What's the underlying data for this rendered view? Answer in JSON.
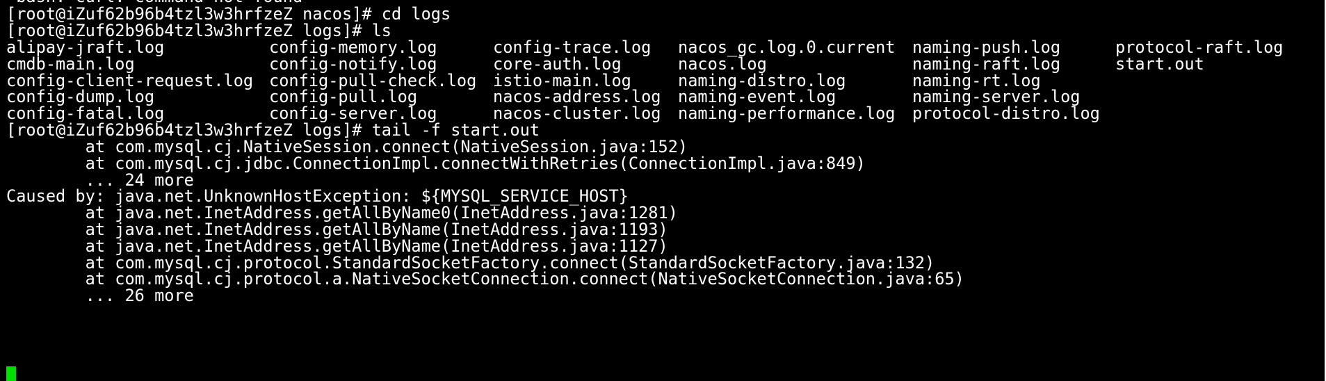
{
  "terminal": {
    "top_partial": "-bash: curl: command not found",
    "prompt_cd": "[root@iZuf62b96b4tzl3w3hrfzeZ nacos]# cd logs",
    "prompt_ls": "[root@iZuf62b96b4tzl3w3hrfzeZ logs]# ls",
    "ls_rows": [
      [
        "alipay-jraft.log",
        "config-memory.log",
        "config-trace.log",
        "nacos_gc.log.0.current",
        "naming-push.log",
        "protocol-raft.log"
      ],
      [
        "cmdb-main.log",
        "config-notify.log",
        "core-auth.log",
        "nacos.log",
        "naming-raft.log",
        "start.out"
      ],
      [
        "config-client-request.log",
        "config-pull-check.log",
        "istio-main.log",
        "naming-distro.log",
        "naming-rt.log",
        ""
      ],
      [
        "config-dump.log",
        "config-pull.log",
        "nacos-address.log",
        "naming-event.log",
        "naming-server.log",
        ""
      ],
      [
        "config-fatal.log",
        "config-server.log",
        "nacos-cluster.log",
        "naming-performance.log",
        "protocol-distro.log",
        ""
      ]
    ],
    "prompt_tail": "[root@iZuf62b96b4tzl3w3hrfzeZ logs]# tail -f start.out",
    "output": [
      "        at com.mysql.cj.NativeSession.connect(NativeSession.java:152)",
      "        at com.mysql.cj.jdbc.ConnectionImpl.connectWithRetries(ConnectionImpl.java:849)",
      "        ... 24 more",
      "Caused by: java.net.UnknownHostException: ${MYSQL_SERVICE_HOST}",
      "        at java.net.InetAddress.getAllByName0(InetAddress.java:1281)",
      "        at java.net.InetAddress.getAllByName(InetAddress.java:1193)",
      "        at java.net.InetAddress.getAllByName(InetAddress.java:1127)",
      "        at com.mysql.cj.protocol.StandardSocketFactory.connect(StandardSocketFactory.java:132)",
      "        at com.mysql.cj.protocol.a.NativeSocketConnection.connect(NativeSocketConnection.java:65)",
      "        ... 26 more"
    ],
    "colors": {
      "background": "#000000",
      "foreground": "#ffffff",
      "cursor": "#00e000"
    }
  }
}
